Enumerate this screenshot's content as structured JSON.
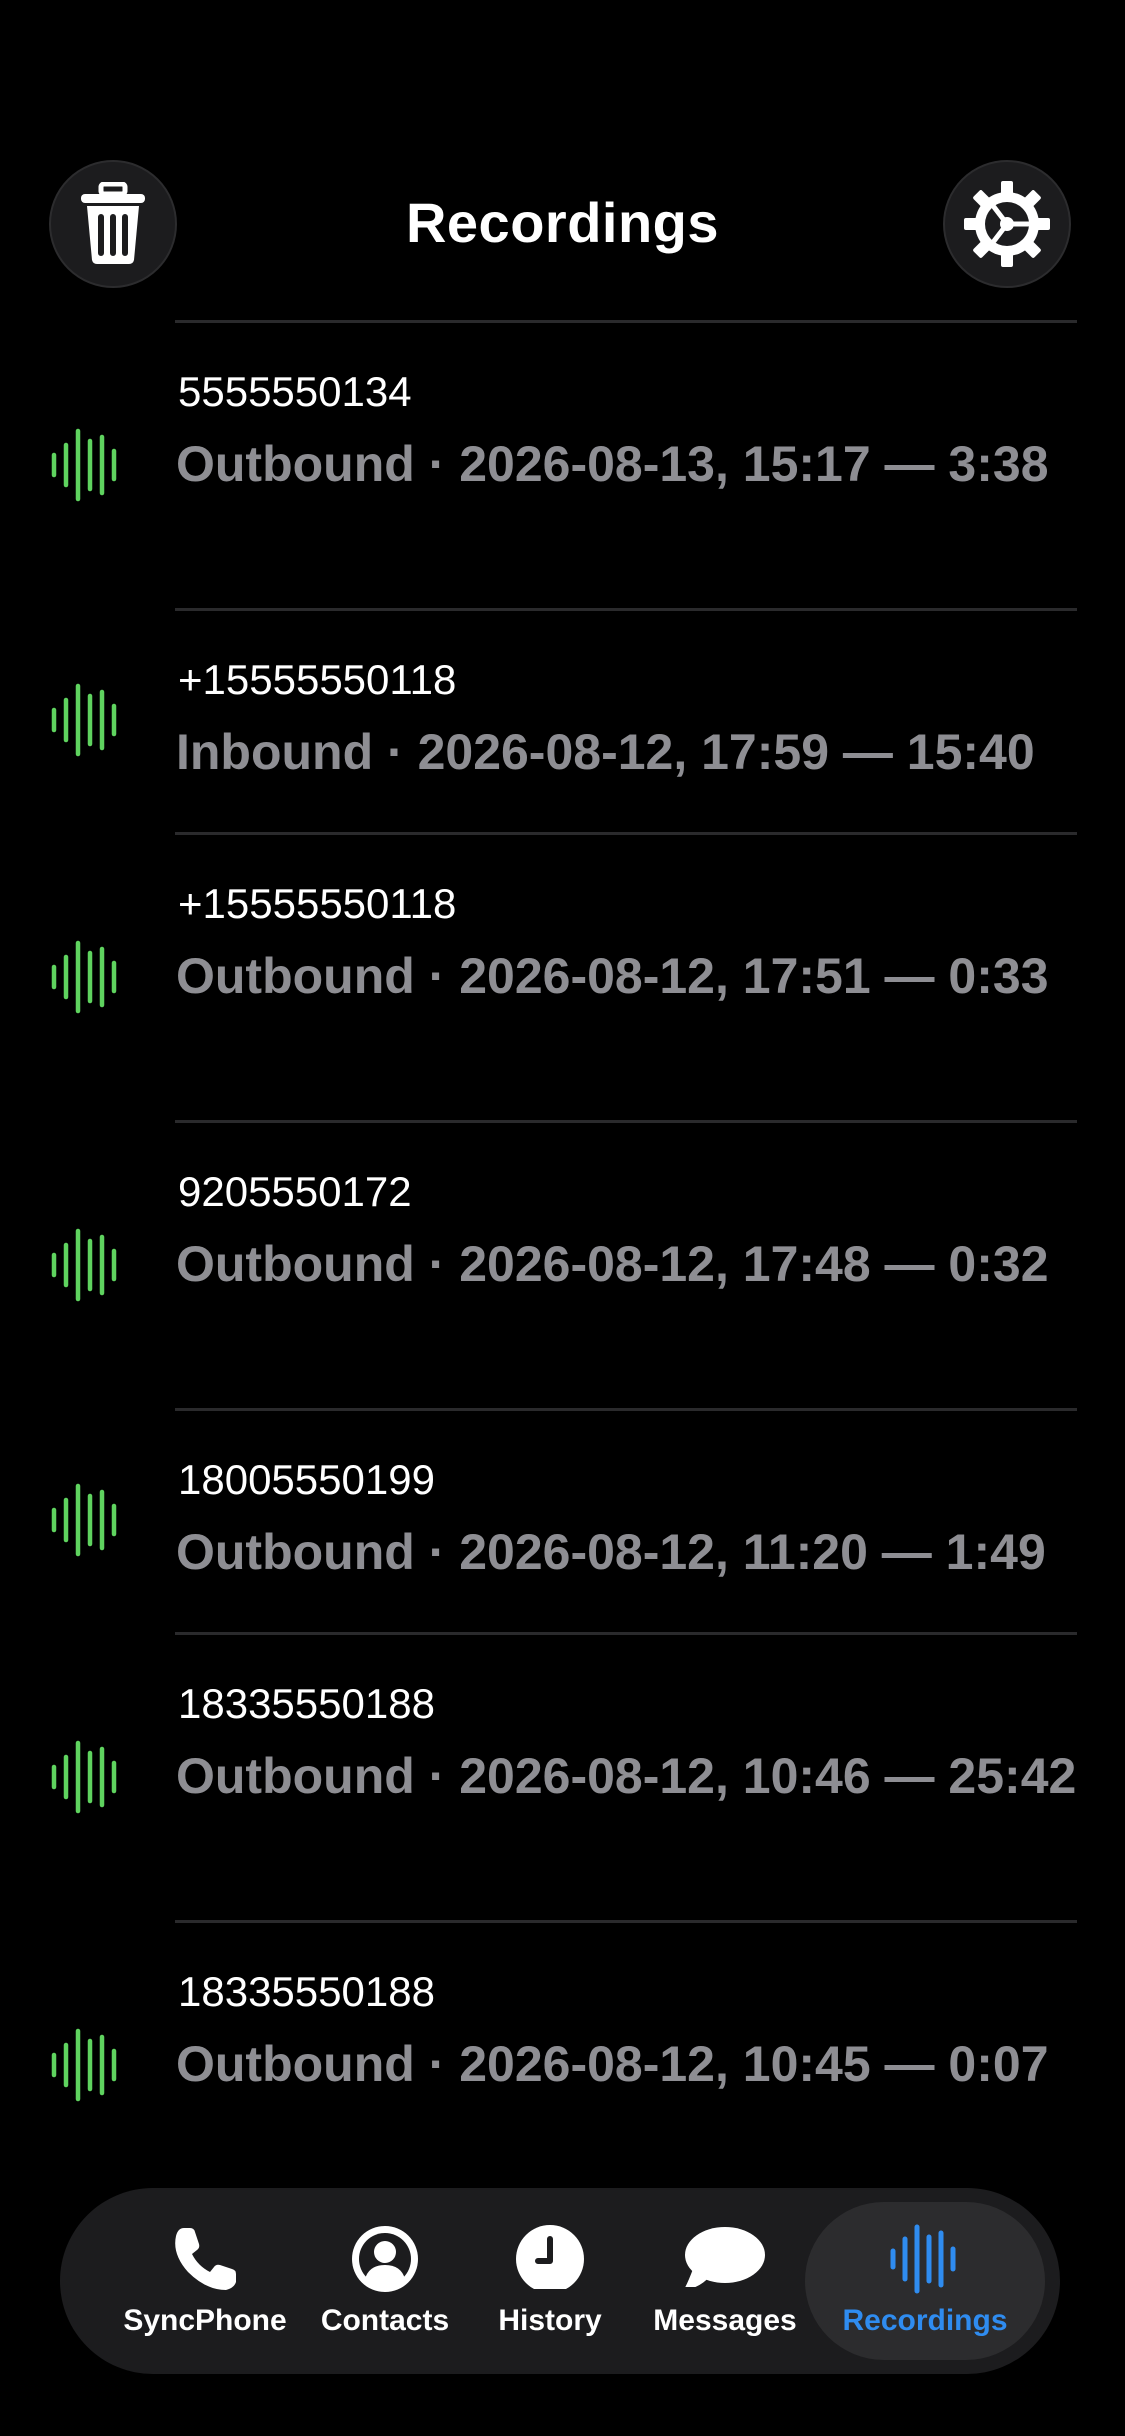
{
  "header": {
    "title": "Recordings"
  },
  "recordings": [
    {
      "number": "5555550134",
      "meta": "Outbound · 2026-08-13, 15:17 — 3:38"
    },
    {
      "number": "+15555550118",
      "meta": "Inbound · 2026-08-12, 17:59 — 15:40"
    },
    {
      "number": "+15555550118",
      "meta": "Outbound · 2026-08-12, 17:51 — 0:33"
    },
    {
      "number": "9205550172",
      "meta": "Outbound · 2026-08-12, 17:48 — 0:32"
    },
    {
      "number": "18005550199",
      "meta": "Outbound · 2026-08-12, 11:20 — 1:49"
    },
    {
      "number": "18335550188",
      "meta": "Outbound · 2026-08-12, 10:46 — 25:42"
    },
    {
      "number": "18335550188",
      "meta": "Outbound · 2026-08-12, 10:45 — 0:07"
    }
  ],
  "tabs": [
    {
      "label": "SyncPhone",
      "icon": "phone-icon"
    },
    {
      "label": "Contacts",
      "icon": "contacts-icon"
    },
    {
      "label": "History",
      "icon": "clock-icon"
    },
    {
      "label": "Messages",
      "icon": "message-icon"
    },
    {
      "label": "Recordings",
      "icon": "waveform-icon",
      "active": true
    }
  ],
  "colors": {
    "waveform": "#5fd35f",
    "active_tab": "#2f8cf0",
    "secondary_text": "#8e8e93"
  }
}
